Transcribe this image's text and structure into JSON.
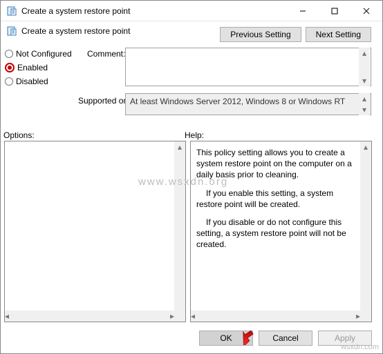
{
  "window": {
    "title": "Create a system restore point"
  },
  "subheader": {
    "title": "Create a system restore point"
  },
  "nav": {
    "prev": "Previous Setting",
    "next": "Next Setting"
  },
  "settings": {
    "not_configured": "Not Configured",
    "enabled": "Enabled",
    "disabled": "Disabled",
    "selected": "enabled"
  },
  "labels": {
    "comment": "Comment:",
    "supported": "Supported on:",
    "options": "Options:",
    "help": "Help:"
  },
  "comment_value": "",
  "supported_value": "At least Windows Server 2012, Windows 8 or Windows RT",
  "help": {
    "p1": "This policy setting allows you to create a system restore point on the computer on a daily basis prior to cleaning.",
    "p2": "If you enable this setting, a system restore point will be created.",
    "p3": "If you disable or do not configure this setting, a system restore point will not be created."
  },
  "buttons": {
    "ok": "OK",
    "cancel": "Cancel",
    "apply": "Apply"
  },
  "watermark": "www.wsxdn.org",
  "watermark2": "wsxdn.com"
}
